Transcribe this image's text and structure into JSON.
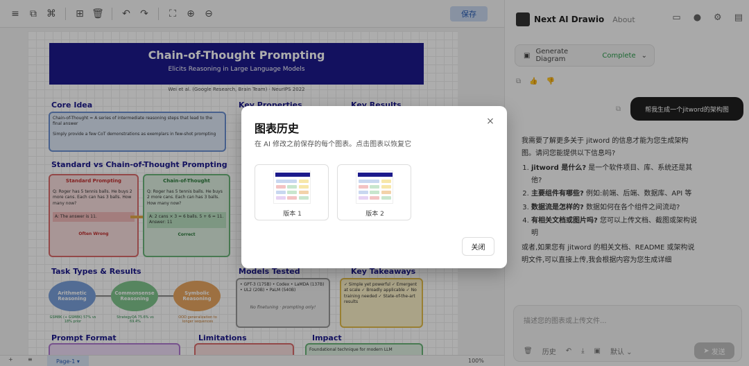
{
  "editor": {
    "save_label": "保存",
    "page_tab": "Page-1",
    "zoom": "100%",
    "diagram": {
      "title": "Chain-of-Thought Prompting",
      "subtitle": "Elicits Reasoning in Large Language Models",
      "authors": "Wei et al. (Google Research, Brain Team) · NeurIPS 2022",
      "core_idea": "Core Idea",
      "key_properties": "Key Properties",
      "key_results": "Key Results",
      "core_text": "Chain-of-Thought = A series of intermediate reasoning steps that lead to the final answer",
      "core_text2": "Simply provide a few CoT demonstrations as exemplars in few-shot prompting",
      "compare_title": "Standard vs Chain-of-Thought Prompting",
      "standard": "Standard Prompting",
      "standard_q": "Q: Roger has 5 tennis balls. He buys 2 more cans. Each can has 3 balls. How many now?",
      "standard_a": "A: The answer is 11.",
      "standard_verdict": "Often Wrong",
      "cot": "Chain-of-Thought",
      "cot_q": "Q: Roger has 5 tennis balls. He buys 2 more cans. Each can has 3 balls. How many now?",
      "cot_a": "A: 2 cans × 3 = 6 balls. 5 + 6 = 11. Answer: 11",
      "cot_verdict": "Correct",
      "task_title": "Task Types & Results",
      "task_arith": "Arithmetic Reasoning",
      "task_common": "Commonsense Reasoning",
      "task_symbolic": "Symbolic Reasoning",
      "cap_arith": "GSM8K (+ GSM8K) 57% vs 18% prior",
      "cap_common": "StrategyQA 75.6% vs 69.4%",
      "cap_symbolic": "OOD generalization to longer sequences",
      "models_title": "Models Tested",
      "models_list": "• GPT-3 (175B)  • Codex  • LaMDA (137B)  • UL2 (20B)  • PaLM (540B)",
      "models_note": "No finetuning · prompting only!",
      "takeaways_title": "Key Takeaways",
      "takeaways": "✓ Simple yet powerful  ✓ Emergent at scale  ✓ Broadly applicable  ✓ No training needed  ✓ State-of-the-art results",
      "prompt_format": "Prompt Format",
      "limitations": "Limitations",
      "impact": "Impact",
      "impact_text": "Foundational technique for modern LLM"
    }
  },
  "panel": {
    "brand": "Next AI Drawio",
    "about": "About",
    "status_label": "Generate Diagram",
    "status_value": "Complete",
    "user_message": "帮我生成一个jitword的架构图",
    "ai_intro": "我需要了解更多关于 jitword 的信息才能为您生成架构图。请问您能提供以下信息吗?",
    "q1_bold": "jitword 是什么?",
    "q1_rest": " 是一个软件项目、库、系统还是其他?",
    "q2_bold": "主要组件有哪些?",
    "q2_rest": " 例如:前端、后端、数据库、API 等",
    "q3_bold": "数据流是怎样的?",
    "q3_rest": " 数据如何在各个组件之间流动?",
    "q4_bold": "有相关文档或图片吗?",
    "q4_rest": " 您可以上传文档、截图或架构说明",
    "ai_outro": "或者,如果您有 jitword 的相关文档、README 或架构说明文件,可以直接上传,我会根据内容为您生成详细",
    "input_placeholder": "描述您的图表或上传文件...",
    "tool_history": "历史",
    "tool_model": "默认",
    "send_label": "发送"
  },
  "modal": {
    "title": "图表历史",
    "description": "在 AI 修改之前保存的每个图表。点击图表以恢复它",
    "versions": [
      {
        "label": "版本 1"
      },
      {
        "label": "版本 2"
      }
    ],
    "close_label": "关闭",
    "close_icon": "×"
  },
  "colors": {
    "dark_blue": "#1c1a8c",
    "complete_green": "#2a9a4a",
    "bubble_dark": "#1f1f1f"
  }
}
